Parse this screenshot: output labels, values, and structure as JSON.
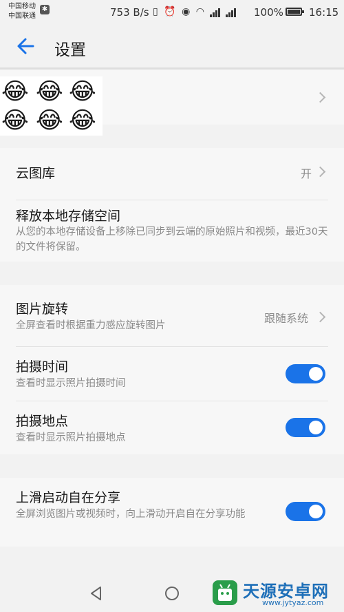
{
  "status_bar": {
    "carrier_1": "中国移动",
    "carrier_2": "中国联通",
    "net_speed": "753 B/s",
    "battery": "100%",
    "time": "16:15"
  },
  "app_bar": {
    "back_icon": "arrow-left-icon",
    "title": "设置"
  },
  "avatar": {
    "emoji": "😂"
  },
  "cloud_section": {
    "gallery": {
      "title": "云图库",
      "value": "开"
    },
    "free_storage": {
      "title": "释放本地存储空间",
      "subtitle": "从您的本地存储设备上移除已同步到云端的原始照片和视频，最近30天的文件将保留。"
    }
  },
  "image_section": {
    "rotation": {
      "title": "图片旋转",
      "subtitle": "全屏查看时根据重力感应旋转图片",
      "value": "跟随系统"
    },
    "shoot_time": {
      "title": "拍摄时间",
      "subtitle": "查看时显示照片拍摄时间",
      "enabled": true
    },
    "shoot_place": {
      "title": "拍摄地点",
      "subtitle": "查看时显示照片拍摄地点",
      "enabled": true
    }
  },
  "share_section": {
    "swipe_share": {
      "title": "上滑启动自在分享",
      "subtitle": "全屏浏览图片或视频时，向上滑动开启自在分享功能",
      "enabled": true
    }
  },
  "nav_bar": {
    "back": "triangle-back-icon",
    "home": "circle-home-icon"
  },
  "watermark": {
    "name": "天源安卓网",
    "url": "www.jytyaz.com"
  },
  "colors": {
    "accent": "#1a73e8",
    "background": "#f2f2f2",
    "card": "#f7f7f7",
    "watermark": "#1e6fb8"
  }
}
